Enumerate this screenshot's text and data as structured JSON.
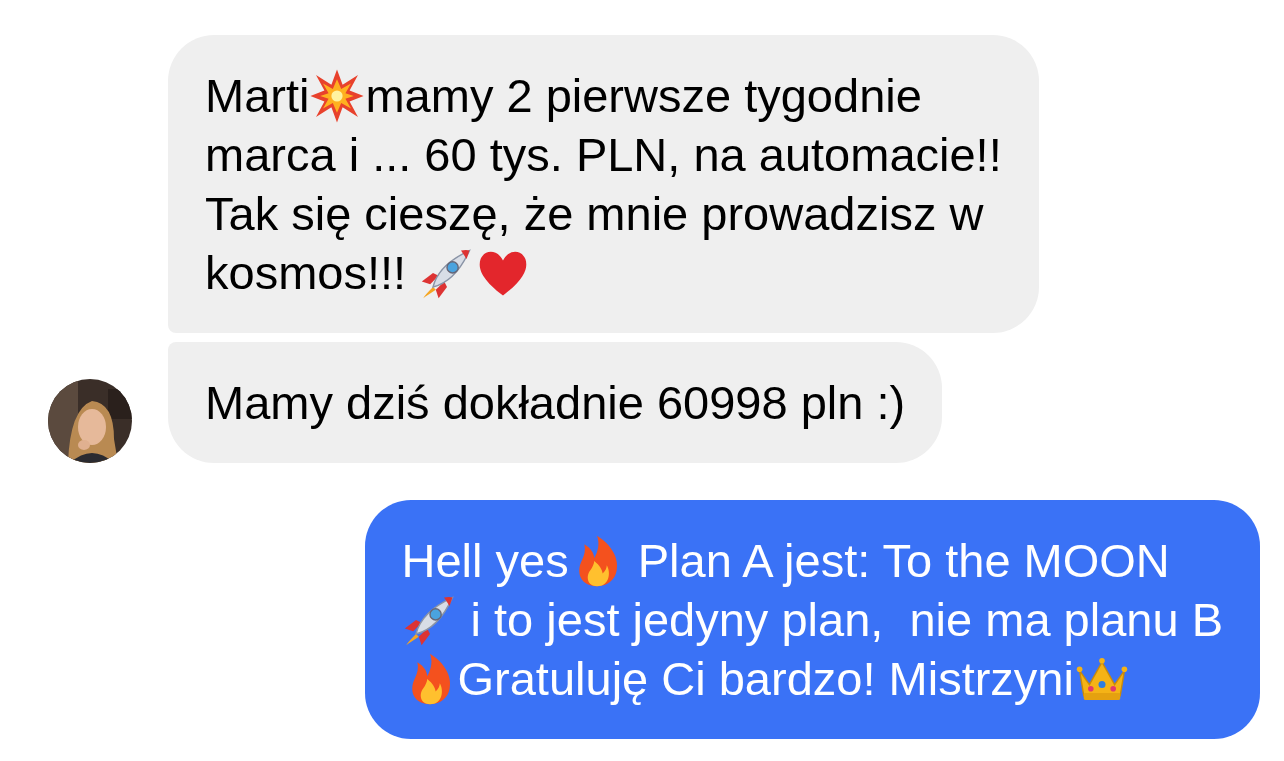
{
  "messages": [
    {
      "sent": false,
      "avatar": false,
      "lines": [
        [
          {
            "kind": "text",
            "text": "Marti"
          },
          {
            "kind": "burst"
          },
          {
            "kind": "text",
            "text": "mamy 2 pierwsze tygodnie"
          }
        ],
        [
          {
            "kind": "text",
            "text": "marca i ... 60 tys. PLN, na automacie!!"
          }
        ],
        [
          {
            "kind": "text",
            "text": "Tak się cieszę, że mnie prowadzisz w"
          }
        ],
        [
          {
            "kind": "text",
            "text": "kosmos!!! "
          },
          {
            "kind": "rocket"
          },
          {
            "kind": "heart"
          }
        ]
      ]
    },
    {
      "sent": false,
      "avatar": true,
      "lines": [
        [
          {
            "kind": "text",
            "text": "Mamy dziś dokładnie 60998 pln :)"
          }
        ]
      ]
    },
    {
      "sent": true,
      "avatar": false,
      "lines": [
        [
          {
            "kind": "text",
            "text": "Hell yes"
          },
          {
            "kind": "fire"
          },
          {
            "kind": "text",
            "text": " Plan A jest: To the MOON"
          }
        ],
        [
          {
            "kind": "rocket"
          },
          {
            "kind": "text",
            "text": " i to jest jedyny plan,  nie ma planu B"
          }
        ],
        [
          {
            "kind": "fire"
          },
          {
            "kind": "text",
            "text": "Gratuluję Ci bardzo! Mistrzyni"
          },
          {
            "kind": "crown"
          }
        ]
      ]
    }
  ]
}
